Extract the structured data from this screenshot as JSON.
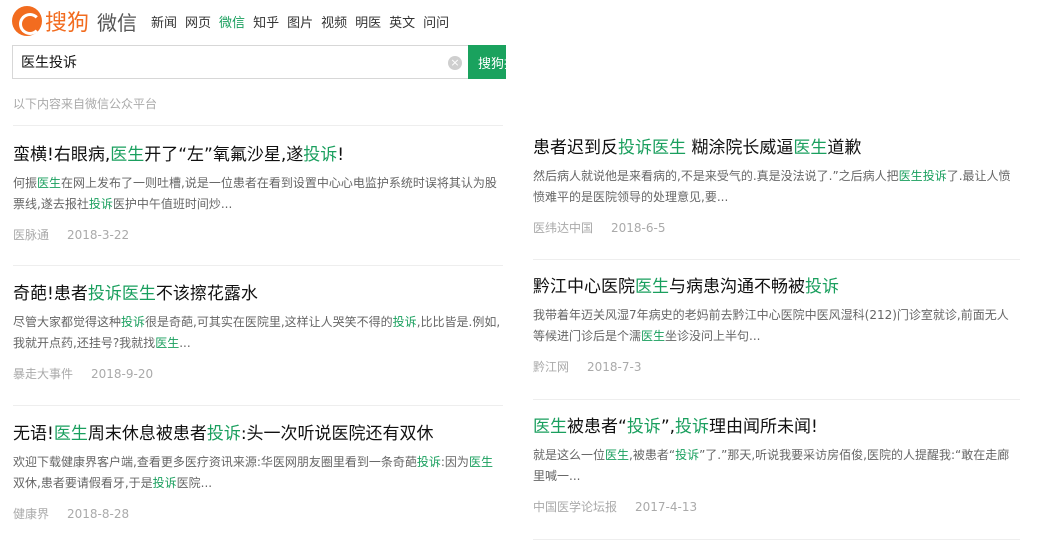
{
  "logo": {
    "brand": "搜狗",
    "product": "微信",
    "brand_color": "#f26c1f"
  },
  "nav": [
    {
      "label": "新闻",
      "active": false
    },
    {
      "label": "网页",
      "active": false
    },
    {
      "label": "微信",
      "active": true
    },
    {
      "label": "知乎",
      "active": false
    },
    {
      "label": "图片",
      "active": false
    },
    {
      "label": "视频",
      "active": false
    },
    {
      "label": "明医",
      "active": false
    },
    {
      "label": "英文",
      "active": false
    },
    {
      "label": "问问",
      "active": false
    }
  ],
  "search": {
    "value": "医生投诉",
    "button_label": "搜狗搜索",
    "clear_icon": "×"
  },
  "source_note": "以下内容来自微信公众平台",
  "colors": {
    "accent": "#1a9f5e",
    "meta": "#aaaaaa"
  },
  "results_left": [
    {
      "title": [
        {
          "t": "蛮横!右眼病,",
          "h": false
        },
        {
          "t": "医生",
          "h": true
        },
        {
          "t": "开了“左”氧氟沙星,遂",
          "h": false
        },
        {
          "t": "投诉",
          "h": true
        },
        {
          "t": "!",
          "h": false
        }
      ],
      "snippet": [
        {
          "t": "何振",
          "h": false
        },
        {
          "t": "医生",
          "h": true
        },
        {
          "t": "在网上发布了一则吐槽,说是一位患者在看到设置中心心电监护系统时误将其认为股票线,遂去报社",
          "h": false
        },
        {
          "t": "投诉",
          "h": true
        },
        {
          "t": "医护中午值班时间炒...",
          "h": false
        }
      ],
      "source": "医脉通",
      "date": "2018-3-22"
    },
    {
      "title": [
        {
          "t": "奇葩!患者",
          "h": false
        },
        {
          "t": "投诉",
          "h": true
        },
        {
          "t": "医生",
          "h": true
        },
        {
          "t": "不该擦花露水",
          "h": false
        }
      ],
      "snippet": [
        {
          "t": "尽管大家都觉得这种",
          "h": false
        },
        {
          "t": "投诉",
          "h": true
        },
        {
          "t": "很是奇葩,可其实在医院里,这样让人哭笑不得的",
          "h": false
        },
        {
          "t": "投诉",
          "h": true
        },
        {
          "t": ",比比皆是.例如,我就开点药,还挂号?我就找",
          "h": false
        },
        {
          "t": "医生",
          "h": true
        },
        {
          "t": "...",
          "h": false
        }
      ],
      "source": "暴走大事件",
      "date": "2018-9-20"
    },
    {
      "title": [
        {
          "t": "无语!",
          "h": false
        },
        {
          "t": "医生",
          "h": true
        },
        {
          "t": "周末休息被患者",
          "h": false
        },
        {
          "t": "投诉",
          "h": true
        },
        {
          "t": ":头一次听说医院还有双休",
          "h": false
        }
      ],
      "snippet": [
        {
          "t": "欢迎下载健康界客户端,查看更多医疗资讯来源:华医网朋友圈里看到一条奇葩",
          "h": false
        },
        {
          "t": "投诉",
          "h": true
        },
        {
          "t": ":因为",
          "h": false
        },
        {
          "t": "医生",
          "h": true
        },
        {
          "t": "双休,患者要请假看牙,于是",
          "h": false
        },
        {
          "t": "投诉",
          "h": true
        },
        {
          "t": "医院...",
          "h": false
        }
      ],
      "source": "健康界",
      "date": "2018-8-28"
    }
  ],
  "results_right": [
    {
      "title": [
        {
          "t": "患者迟到反",
          "h": false
        },
        {
          "t": "投诉",
          "h": true
        },
        {
          "t": "医生",
          "h": true
        },
        {
          "t": " 糊涂院长威逼",
          "h": false
        },
        {
          "t": "医生",
          "h": true
        },
        {
          "t": "道歉",
          "h": false
        }
      ],
      "snippet": [
        {
          "t": "然后病人就说他是来看病的,不是来受气的.真是没法说了.”之后病人把",
          "h": false
        },
        {
          "t": "医生",
          "h": true
        },
        {
          "t": "投诉",
          "h": true
        },
        {
          "t": "了.最让人愤愤难平的是医院领导的处理意见,要...",
          "h": false
        }
      ],
      "source": "医纬达中国",
      "date": "2018-6-5"
    },
    {
      "title": [
        {
          "t": "黔江中心医院",
          "h": false
        },
        {
          "t": "医生",
          "h": true
        },
        {
          "t": "与病患沟通不畅被",
          "h": false
        },
        {
          "t": "投诉",
          "h": true
        }
      ],
      "snippet": [
        {
          "t": "我带着年迈关风湿7年病史的老妈前去黔江中心医院中医风湿科(212)门诊室就诊,前面无人等候进门诊后是个濡",
          "h": false
        },
        {
          "t": "医生",
          "h": true
        },
        {
          "t": "坐诊没问上半句...",
          "h": false
        }
      ],
      "source": "黔江网",
      "date": "2018-7-3"
    },
    {
      "title": [
        {
          "t": "医生",
          "h": true
        },
        {
          "t": "被患者“",
          "h": false
        },
        {
          "t": "投诉",
          "h": true
        },
        {
          "t": "”,",
          "h": false
        },
        {
          "t": "投诉",
          "h": true
        },
        {
          "t": "理由闻所未闻!",
          "h": false
        }
      ],
      "snippet": [
        {
          "t": "就是这么一位",
          "h": false
        },
        {
          "t": "医生",
          "h": true
        },
        {
          "t": ",被患者“",
          "h": false
        },
        {
          "t": "投诉",
          "h": true
        },
        {
          "t": "”了.”那天,听说我要采访房佰俊,医院的人提醒我:“敢在走廊里喊一...",
          "h": false
        }
      ],
      "source": "中国医学论坛报",
      "date": "2017-4-13"
    }
  ]
}
